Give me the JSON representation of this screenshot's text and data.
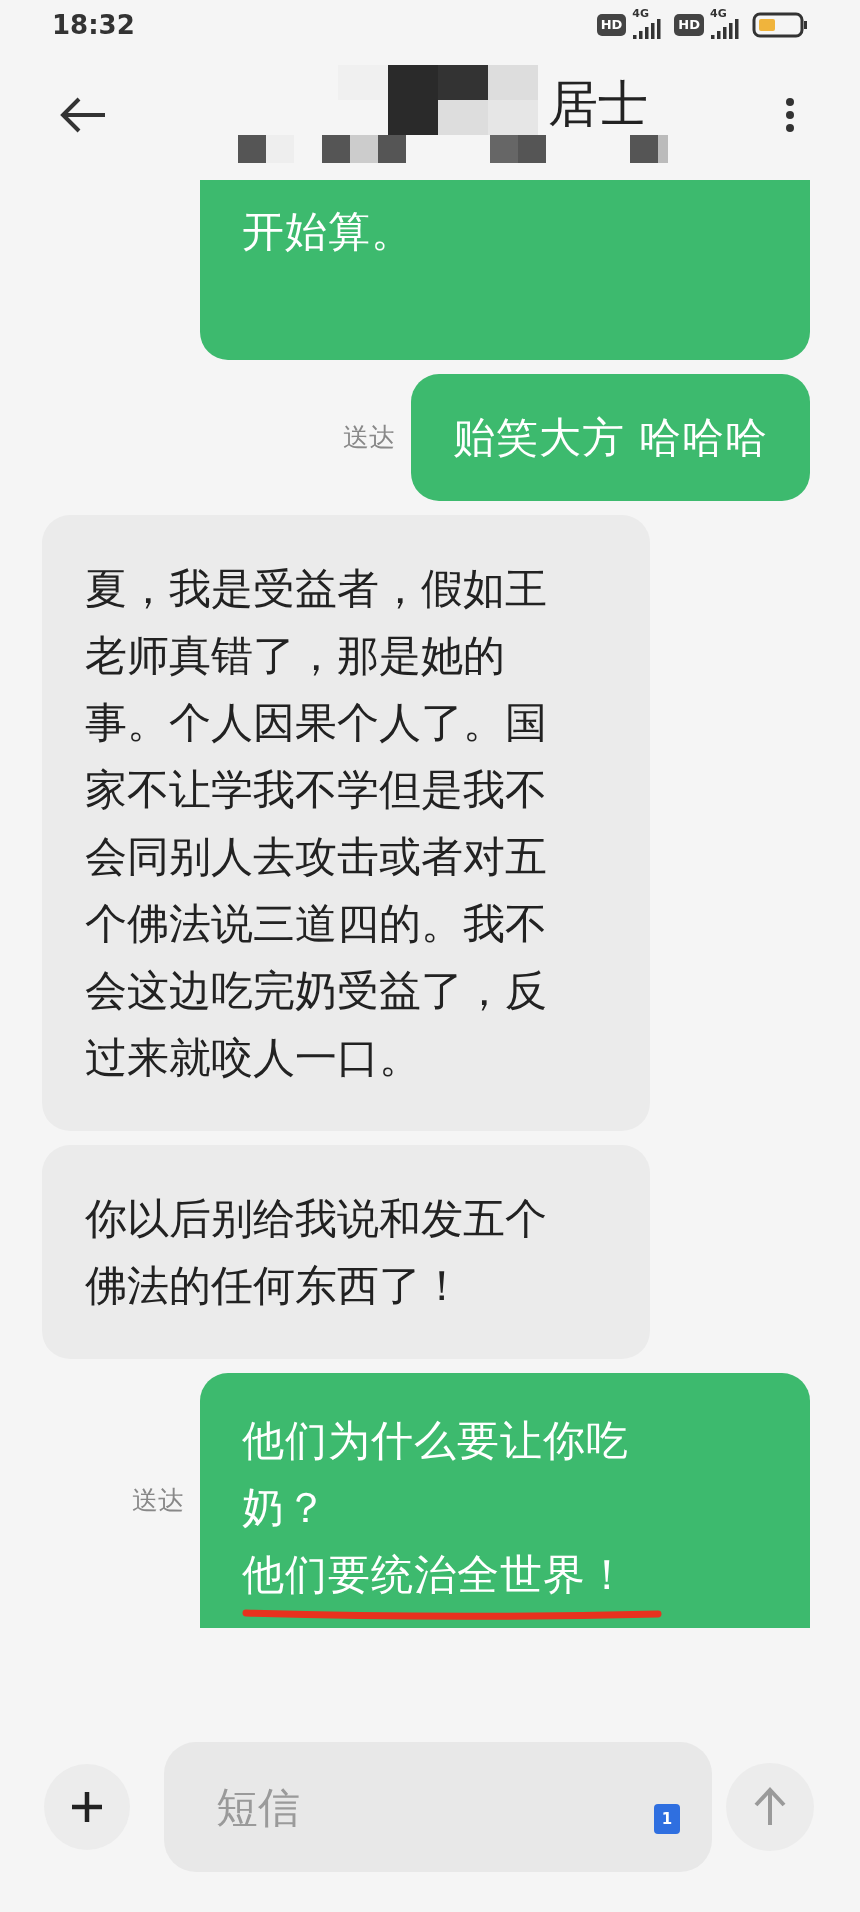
{
  "status_bar": {
    "time": "18:32",
    "sims": [
      {
        "label": "HD",
        "network": "4G"
      },
      {
        "label": "HD",
        "network": "4G"
      }
    ]
  },
  "header": {
    "title": "居士"
  },
  "messages": [
    {
      "kind": "sent",
      "paragraphs": [
        {
          "text": "开始算。",
          "underlined": false
        }
      ]
    },
    {
      "kind": "sent",
      "status": "送达",
      "paragraphs": [
        {
          "text": "贻笑大方 哈哈哈",
          "underlined": false
        }
      ]
    },
    {
      "kind": "received",
      "paragraphs": [
        {
          "text": "夏，我是受益者，假如王老师真错了，那是她的事。个人因果个人了。国家不让学我不学但是我不会同别人去攻击或者对五个佛法说三道四的。我不会这边吃完奶受益了，反过来就咬人一口。",
          "underlined": false
        }
      ]
    },
    {
      "kind": "received",
      "paragraphs": [
        {
          "text": "你以后别给我说和发五个佛法的任何东西了！",
          "underlined": false
        }
      ]
    },
    {
      "kind": "sent",
      "status": "送达",
      "paragraphs": [
        {
          "text": "他们为什么要让你吃奶？",
          "underlined": false
        },
        {
          "text": "他们要统治全世界！",
          "underlined": true
        }
      ]
    }
  ],
  "composer": {
    "placeholder": "短信",
    "sim_badge": "1"
  }
}
